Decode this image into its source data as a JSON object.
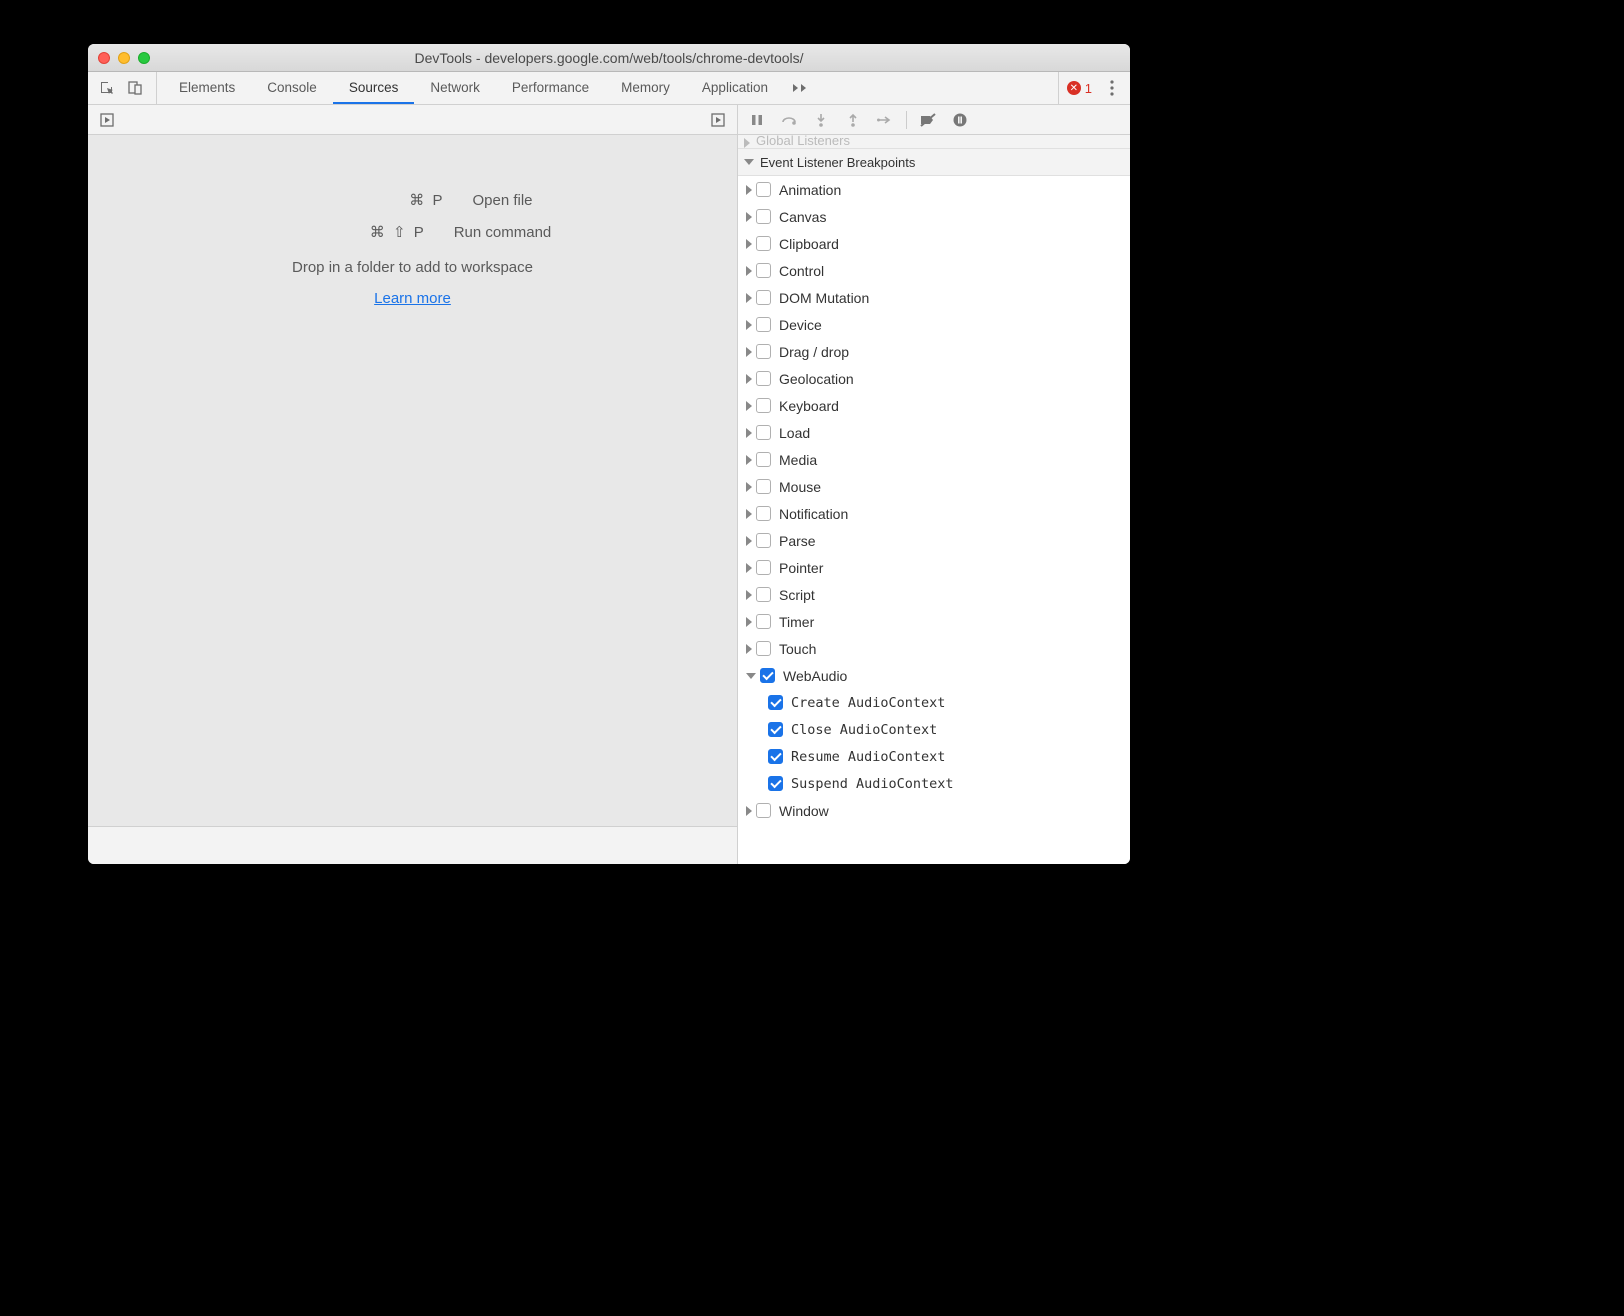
{
  "window": {
    "title": "DevTools - developers.google.com/web/tools/chrome-devtools/"
  },
  "tabs": {
    "items": [
      "Elements",
      "Console",
      "Sources",
      "Network",
      "Performance",
      "Memory",
      "Application"
    ],
    "active": "Sources"
  },
  "errors": {
    "count": "1"
  },
  "empty_state": {
    "open_file_keys": "⌘ P",
    "open_file_label": "Open file",
    "run_cmd_keys": "⌘ ⇧ P",
    "run_cmd_label": "Run command",
    "drop_text": "Drop in a folder to add to workspace",
    "learn_more": "Learn more"
  },
  "right": {
    "global_listeners": "Global Listeners",
    "section_title": "Event Listener Breakpoints",
    "categories": [
      {
        "label": "Animation",
        "expanded": false,
        "checked": false
      },
      {
        "label": "Canvas",
        "expanded": false,
        "checked": false
      },
      {
        "label": "Clipboard",
        "expanded": false,
        "checked": false
      },
      {
        "label": "Control",
        "expanded": false,
        "checked": false
      },
      {
        "label": "DOM Mutation",
        "expanded": false,
        "checked": false
      },
      {
        "label": "Device",
        "expanded": false,
        "checked": false
      },
      {
        "label": "Drag / drop",
        "expanded": false,
        "checked": false
      },
      {
        "label": "Geolocation",
        "expanded": false,
        "checked": false
      },
      {
        "label": "Keyboard",
        "expanded": false,
        "checked": false
      },
      {
        "label": "Load",
        "expanded": false,
        "checked": false
      },
      {
        "label": "Media",
        "expanded": false,
        "checked": false
      },
      {
        "label": "Mouse",
        "expanded": false,
        "checked": false
      },
      {
        "label": "Notification",
        "expanded": false,
        "checked": false
      },
      {
        "label": "Parse",
        "expanded": false,
        "checked": false
      },
      {
        "label": "Pointer",
        "expanded": false,
        "checked": false
      },
      {
        "label": "Script",
        "expanded": false,
        "checked": false
      },
      {
        "label": "Timer",
        "expanded": false,
        "checked": false
      },
      {
        "label": "Touch",
        "expanded": false,
        "checked": false
      },
      {
        "label": "WebAudio",
        "expanded": true,
        "checked": true,
        "children": [
          {
            "label": "Create AudioContext",
            "checked": true
          },
          {
            "label": "Close AudioContext",
            "checked": true
          },
          {
            "label": "Resume AudioContext",
            "checked": true
          },
          {
            "label": "Suspend AudioContext",
            "checked": true
          }
        ]
      },
      {
        "label": "Window",
        "expanded": false,
        "checked": false
      }
    ]
  }
}
